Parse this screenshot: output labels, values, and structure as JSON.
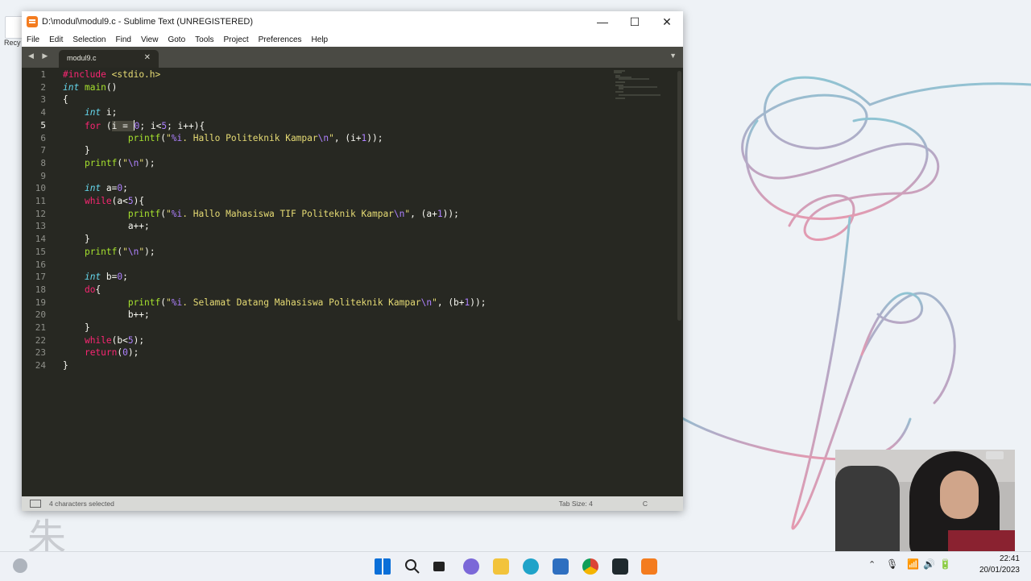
{
  "desktop": {
    "icon_label": "Recy",
    "watermark": "朱"
  },
  "window": {
    "title": "D:\\modul\\modul9.c - Sublime Text (UNREGISTERED)",
    "controls": {
      "minimize": "—",
      "maximize": "☐",
      "close": "✕"
    }
  },
  "menu": [
    "File",
    "Edit",
    "Selection",
    "Find",
    "View",
    "Goto",
    "Tools",
    "Project",
    "Preferences",
    "Help"
  ],
  "tabbar": {
    "nav": "◀ ▶",
    "tab_label": "modul9.c",
    "tab_close": "✕",
    "menu_arrow": "▼"
  },
  "editor": {
    "active_line": 5,
    "line_numbers": [
      "1",
      "2",
      "3",
      "4",
      "5",
      "6",
      "7",
      "8",
      "9",
      "10",
      "11",
      "12",
      "13",
      "14",
      "15",
      "16",
      "17",
      "18",
      "19",
      "20",
      "21",
      "22",
      "23",
      "24"
    ]
  },
  "status": {
    "selection": "4 characters selected",
    "tab_size": "Tab Size: 4",
    "syntax": "C"
  },
  "clock": {
    "time": "22:41",
    "date": "20/01/2023"
  },
  "taskbar_icons": [
    "windows-start-icon",
    "search-icon",
    "task-view-icon",
    "chat-icon",
    "file-explorer-icon",
    "edge-icon",
    "store-icon",
    "chrome-icon",
    "terminal-icon",
    "sublime-icon"
  ],
  "tray": {
    "caret": "⌃",
    "mic": "🎙",
    "wifi": "📶",
    "volume": "🔊",
    "battery": "🔋"
  }
}
